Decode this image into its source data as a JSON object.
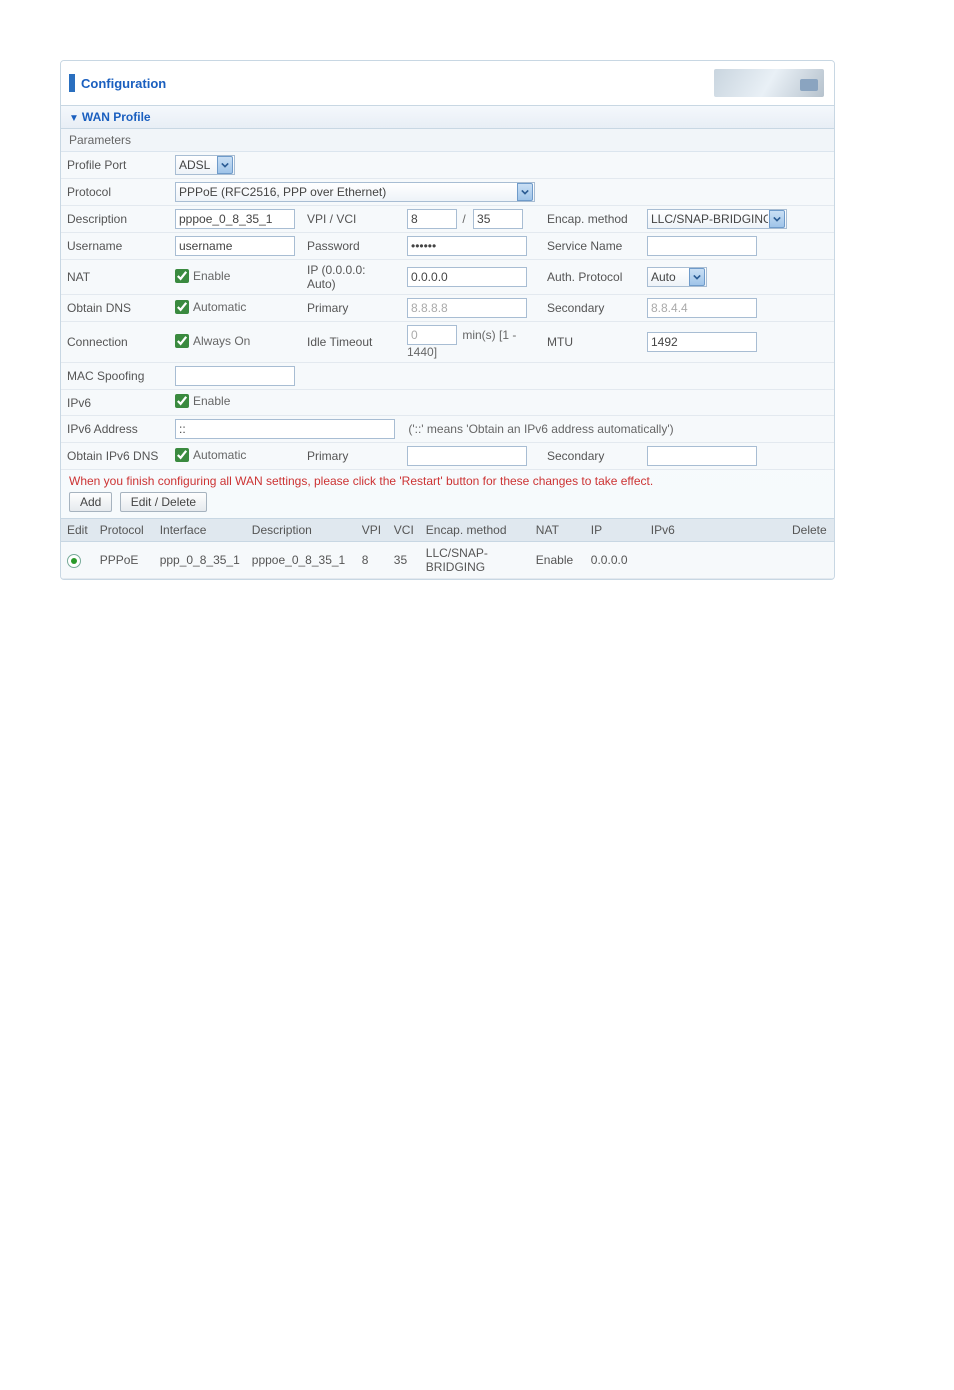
{
  "page_title": "Configuration",
  "section_title": "WAN Profile",
  "subheading": "Parameters",
  "labels": {
    "profile_port": "Profile Port",
    "protocol": "Protocol",
    "description": "Description",
    "vpi_vci": "VPI / VCI",
    "encap": "Encap. method",
    "username": "Username",
    "password": "Password",
    "service_name": "Service Name",
    "nat": "NAT",
    "ip_auto": "IP (0.0.0.0: Auto)",
    "auth_protocol": "Auth. Protocol",
    "obtain_dns": "Obtain DNS",
    "primary": "Primary",
    "secondary": "Secondary",
    "connection": "Connection",
    "idle_timeout": "Idle Timeout",
    "mtu": "MTU",
    "mac_spoofing": "MAC Spoofing",
    "ipv6": "IPv6",
    "ipv6_address": "IPv6 Address",
    "obtain_ipv6_dns": "Obtain IPv6 DNS",
    "enable": "Enable",
    "automatic": "Automatic",
    "always_on": "Always On",
    "minutes_range": "min(s) [1 - 1440]"
  },
  "values": {
    "profile_port": "ADSL",
    "protocol": "PPPoE (RFC2516, PPP over Ethernet)",
    "description": "pppoe_0_8_35_1",
    "vpi": "8",
    "vci": "35",
    "encap_method": "LLC/SNAP-BRIDGING",
    "username": "username",
    "password": "••••••",
    "service_name": "",
    "nat_enable": true,
    "ip": "0.0.0.0",
    "auth_protocol": "Auto",
    "obtain_dns_auto": true,
    "dns_primary": "8.8.8.8",
    "dns_secondary": "8.8.4.4",
    "connection_always_on": true,
    "idle_timeout": "0",
    "mtu": "1492",
    "mac_spoofing": "",
    "ipv6_enable": true,
    "ipv6_address": "::",
    "ipv6_hint": "('::' means 'Obtain an IPv6 address automatically')",
    "obtain_ipv6_dns_auto": true,
    "ipv6_primary": "",
    "ipv6_secondary": ""
  },
  "note": "When you finish configuring all WAN settings, please click the 'Restart' button for these changes to take effect.",
  "buttons": {
    "add": "Add",
    "edit_delete": "Edit / Delete"
  },
  "list": {
    "headers": {
      "edit": "Edit",
      "protocol": "Protocol",
      "interface": "Interface",
      "description": "Description",
      "vpi": "VPI",
      "vci": "VCI",
      "encap": "Encap. method",
      "nat": "NAT",
      "ip": "IP",
      "ipv6": "IPv6",
      "delete": "Delete"
    },
    "row": {
      "protocol": "PPPoE",
      "interface": "ppp_0_8_35_1",
      "description": "pppoe_0_8_35_1",
      "vpi": "8",
      "vci": "35",
      "encap": "LLC/SNAP-BRIDGING",
      "nat": "Enable",
      "ip": "0.0.0.0",
      "ipv6": "",
      "delete": ""
    }
  }
}
